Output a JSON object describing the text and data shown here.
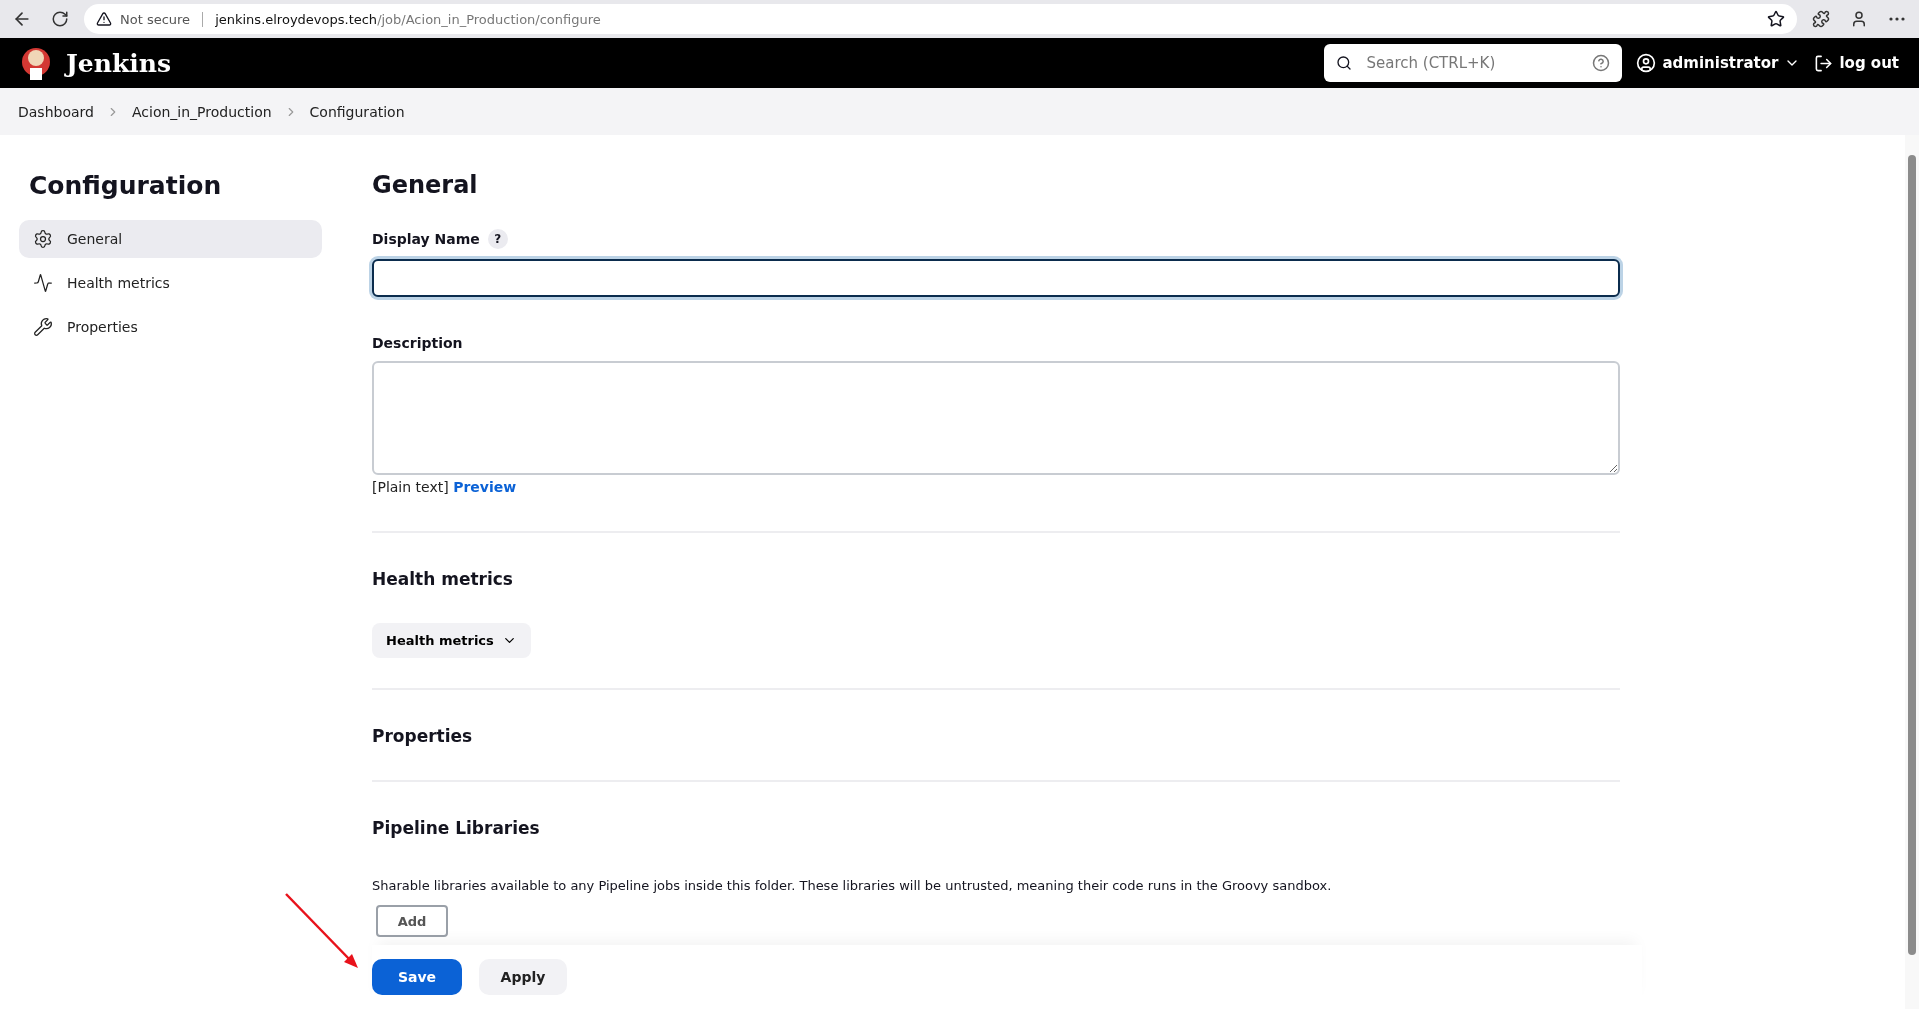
{
  "browser": {
    "security_label": "Not secure",
    "url_host": "jenkins.elroydevops.tech",
    "url_path": "/job/Acion_in_Production/configure"
  },
  "header": {
    "brand": "Jenkins",
    "search_placeholder": "Search (CTRL+K)",
    "user": "administrator",
    "logout": "log out"
  },
  "breadcrumbs": [
    {
      "label": "Dashboard"
    },
    {
      "label": "Acion_in_Production"
    },
    {
      "label": "Configuration"
    }
  ],
  "sidebar": {
    "title": "Configuration",
    "items": [
      {
        "label": "General",
        "selected": true
      },
      {
        "label": "Health metrics",
        "selected": false
      },
      {
        "label": "Properties",
        "selected": false
      }
    ]
  },
  "general": {
    "title": "General",
    "display_name_label": "Display Name",
    "help": "?",
    "description_label": "Description",
    "format_note": "[Plain text]",
    "preview_link": "Preview"
  },
  "health_metrics": {
    "title": "Health metrics",
    "dropdown": "Health metrics"
  },
  "properties": {
    "title": "Properties"
  },
  "pipeline_libraries": {
    "title": "Pipeline Libraries",
    "text": "Sharable libraries available to any Pipeline jobs inside this folder. These libraries will be untrusted, meaning their code runs in the Groovy sandbox.",
    "add_button": "Add"
  },
  "actions": {
    "save": "Save",
    "apply": "Apply"
  }
}
